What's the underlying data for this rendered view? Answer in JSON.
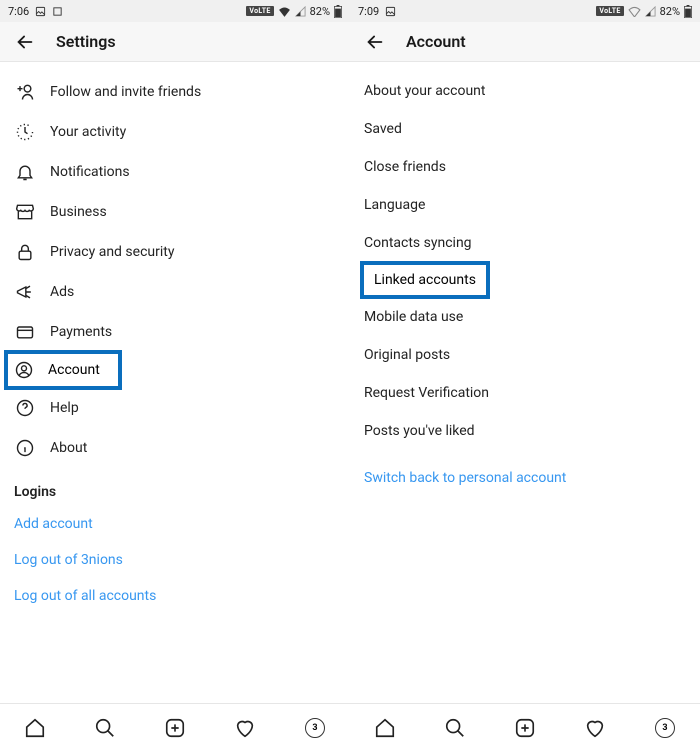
{
  "panels": {
    "left": {
      "status": {
        "time": "7:06",
        "battery": "82%"
      },
      "header": {
        "title": "Settings"
      },
      "items": [
        {
          "label": "Follow and invite friends"
        },
        {
          "label": "Your activity"
        },
        {
          "label": "Notifications"
        },
        {
          "label": "Business"
        },
        {
          "label": "Privacy and security"
        },
        {
          "label": "Ads"
        },
        {
          "label": "Payments"
        },
        {
          "label": "Account"
        },
        {
          "label": "Help"
        },
        {
          "label": "About"
        }
      ],
      "logins_header": "Logins",
      "logins": [
        {
          "label": "Add account"
        },
        {
          "label": "Log out of 3nions"
        },
        {
          "label": "Log out of all accounts"
        }
      ]
    },
    "right": {
      "status": {
        "time": "7:09",
        "battery": "82%"
      },
      "header": {
        "title": "Account"
      },
      "items": [
        {
          "label": "About your account"
        },
        {
          "label": "Saved"
        },
        {
          "label": "Close friends"
        },
        {
          "label": "Language"
        },
        {
          "label": "Contacts syncing"
        },
        {
          "label": "Linked accounts"
        },
        {
          "label": "Mobile data use"
        },
        {
          "label": "Original posts"
        },
        {
          "label": "Request Verification"
        },
        {
          "label": "Posts you've liked"
        }
      ],
      "switch_link": "Switch back to personal account"
    }
  }
}
